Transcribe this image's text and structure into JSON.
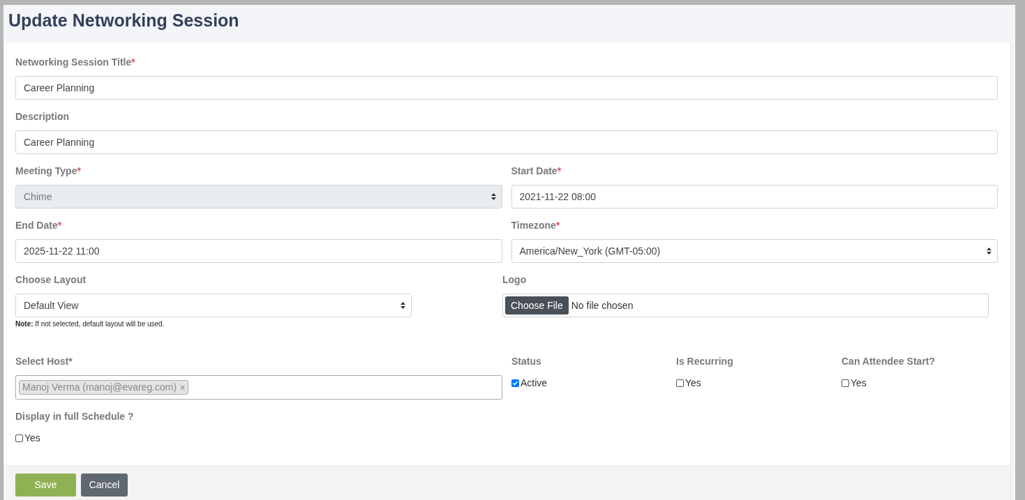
{
  "title": "Update Networking Session",
  "fields": [
    {
      "label": "Networking Session Title",
      "mark": "*",
      "kind": "text",
      "value": "Career Planning",
      "disabled": false
    },
    {
      "label": "Description",
      "kind": "text",
      "value": "Career Planning",
      "disabled": false
    },
    {
      "label": "Meeting Type",
      "mark": "*",
      "kind": "select",
      "value": "Chime",
      "disabled": true
    },
    {
      "label": "Start Date",
      "mark": "*",
      "kind": "text",
      "value": "2021-11-22 08:00",
      "disabled": false
    },
    {
      "label": "End Date",
      "mark": "*",
      "kind": "text",
      "value": "2025-11-22 11:00",
      "disabled": false
    },
    {
      "label": "Timezone",
      "mark": "*",
      "kind": "select",
      "value": "America/New_York (GMT-05:00)",
      "disabled": false
    },
    {
      "label": "Choose Layout",
      "kind": "select",
      "value": "Default View",
      "disabled": false
    },
    {
      "label": "Logo",
      "kind": "file",
      "button": "Choose File",
      "value": "No file chosen",
      "disabled": false
    }
  ],
  "layout_note": "**Note:** If not selected, default layout will be used.",
  "host": {
    "label": "Select Host*",
    "tag": "Manoj Verma (manoj@evareg.com)",
    "remove": "×"
  },
  "checks": [
    {
      "label": "Status",
      "option": "Active",
      "checked": true
    },
    {
      "label": "Is Recurring",
      "option": "Yes",
      "checked": false
    },
    {
      "label": "Can Attendee Start?",
      "option": "Yes",
      "checked": false
    },
    {
      "label": "Display in full Schedule ?",
      "option": "Yes",
      "checked": false
    }
  ],
  "buttons": [
    {
      "label": "Save",
      "kind": "primary"
    },
    {
      "label": "Cancel",
      "kind": "secondary"
    }
  ]
}
